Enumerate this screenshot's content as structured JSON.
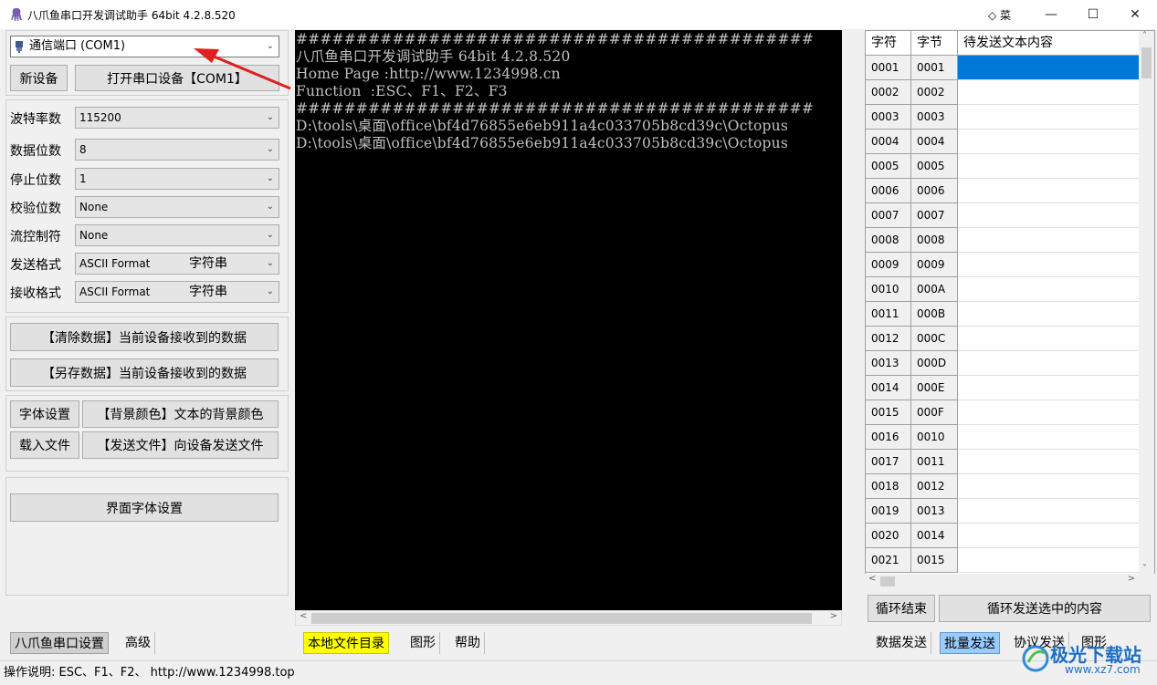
{
  "window": {
    "title": "八爪鱼串口开发调试助手 64bit 4.2.8.520",
    "menu_label": "◇ 菜",
    "minimize": "—",
    "maximize": "☐",
    "close": "✕"
  },
  "port": {
    "selected": "通信端口 (COM1)",
    "new_device": "新设备",
    "open_device": "打开串口设备【COM1】"
  },
  "settings": [
    {
      "label": "波特率数",
      "value": "115200",
      "extra": ""
    },
    {
      "label": "数据位数",
      "value": "8",
      "extra": ""
    },
    {
      "label": "停止位数",
      "value": "1",
      "extra": ""
    },
    {
      "label": "校验位数",
      "value": "None",
      "extra": ""
    },
    {
      "label": "流控制符",
      "value": "None",
      "extra": ""
    },
    {
      "label": "发送格式",
      "value": "ASCII Format",
      "extra": "字符串"
    },
    {
      "label": "接收格式",
      "value": "ASCII Format",
      "extra": "字符串"
    }
  ],
  "actions": {
    "clear": "【清除数据】当前设备接收到的数据",
    "save": "【另存数据】当前设备接收到的数据",
    "font": "字体设置",
    "bg_color": "【背景颜色】文本的背景颜色",
    "load_file": "载入文件",
    "send_file": "【发送文件】向设备发送文件",
    "ui_font": "界面字体设置"
  },
  "console": {
    "lines": [
      "###########################################",
      "八爪鱼串口开发调试助手 64bit 4.2.8.520",
      "Home Page :http://www.1234998.cn",
      "Function  :ESC、F1、F2、F3",
      "###########################################",
      "D:\\tools\\桌面\\office\\bf4d76855e6eb911a4c033705b8cd39c\\Octopus",
      "D:\\tools\\桌面\\office\\bf4d76855e6eb911a4c033705b8cd39c\\Octopus"
    ]
  },
  "grid": {
    "headers": [
      "字符",
      "字节",
      "待发送文本内容"
    ],
    "rows": [
      [
        "0001",
        "0001"
      ],
      [
        "0002",
        "0002"
      ],
      [
        "0003",
        "0003"
      ],
      [
        "0004",
        "0004"
      ],
      [
        "0005",
        "0005"
      ],
      [
        "0006",
        "0006"
      ],
      [
        "0007",
        "0007"
      ],
      [
        "0008",
        "0008"
      ],
      [
        "0009",
        "0009"
      ],
      [
        "0010",
        "000A"
      ],
      [
        "0011",
        "000B"
      ],
      [
        "0012",
        "000C"
      ],
      [
        "0013",
        "000D"
      ],
      [
        "0014",
        "000E"
      ],
      [
        "0015",
        "000F"
      ],
      [
        "0016",
        "0010"
      ],
      [
        "0017",
        "0011"
      ],
      [
        "0018",
        "0012"
      ],
      [
        "0019",
        "0013"
      ],
      [
        "0020",
        "0014"
      ],
      [
        "0021",
        "0015"
      ]
    ],
    "loop_end": "循环结束",
    "loop_send": "循环发送选中的内容"
  },
  "tabs": {
    "left": [
      "八爪鱼串口设置",
      "高级"
    ],
    "middle": [
      "本地文件目录",
      "图形",
      "帮助"
    ],
    "right": [
      "数据发送",
      "批量发送",
      "协议发送",
      "图形"
    ]
  },
  "status": "操作说明: ESC、F1、F2、 http://www.1234998.top",
  "watermark": "极光下载站 www.xz7.com",
  "colors": {
    "selected_cell": "#0078d7",
    "tab_highlight": "#ffff00",
    "batch_tab": "#99ccff",
    "annotation_arrow": "#e02020"
  }
}
